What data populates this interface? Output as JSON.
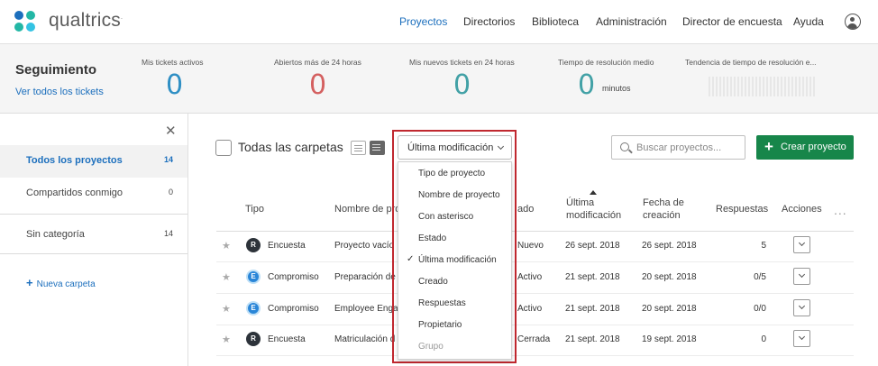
{
  "app": {
    "logo_text": "qualtrics",
    "logo_mark": "."
  },
  "nav": {
    "items": [
      {
        "label": "Proyectos",
        "active": true
      },
      {
        "label": "Directorios"
      },
      {
        "label": "Biblioteca"
      },
      {
        "label": "Administración"
      },
      {
        "label": "Director de encuesta"
      },
      {
        "label": "Ayuda"
      }
    ],
    "user_icon": "user-icon"
  },
  "tracking": {
    "title": "Seguimiento",
    "link": "Ver todos los tickets",
    "metrics": [
      {
        "label": "Mis tickets activos",
        "value": "0",
        "color": "#2f8fc4"
      },
      {
        "label": "Abiertos más de 24 horas",
        "value": "0",
        "color": "#d46060"
      },
      {
        "label": "Mis nuevos tickets en 24 horas",
        "value": "0",
        "color": "#42a1a6"
      },
      {
        "label": "Tiempo de resolución medio",
        "value": "0",
        "unit": "minutos",
        "color": "#42a1a6"
      },
      {
        "label": "Tendencia de tiempo de resolución e..."
      }
    ]
  },
  "sidebar": {
    "close_icon": "close-icon",
    "items": [
      {
        "label": "Todos los proyectos",
        "count": "14",
        "active": true
      },
      {
        "label": "Compartidos conmigo",
        "count": "0"
      },
      {
        "label": "Sin categoría",
        "count": "14"
      }
    ],
    "new_folder": "Nueva carpeta",
    "new_folder_icon": "plus-icon"
  },
  "toolbar": {
    "folders_label": "Todas las carpetas",
    "sort_label": "Última modificación",
    "search_placeholder": "Buscar proyectos...",
    "create_label": "Crear proyecto"
  },
  "table": {
    "headers": {
      "type": "Tipo",
      "name": "Nombre de pro",
      "status": "ado",
      "modified_1": "Última",
      "modified_2": "modificación",
      "created_1": "Fecha de",
      "created_2": "creación",
      "responses": "Respuestas",
      "actions": "Acciones",
      "more": "..."
    },
    "rows": [
      {
        "type": "Encuesta",
        "icon": "R",
        "name": "Proyecto vacío",
        "status": "Nuevo",
        "modified": "26 sept. 2018",
        "created": "26 sept. 2018",
        "responses": "5"
      },
      {
        "type": "Compromiso",
        "icon": "E",
        "name": "Preparación de",
        "status": "Activo",
        "modified": "21 sept. 2018",
        "created": "20 sept. 2018",
        "responses": "0/5"
      },
      {
        "type": "Compromiso",
        "icon": "E",
        "name": "Employee Enga",
        "status": "Activo",
        "modified": "21 sept. 2018",
        "created": "20 sept. 2018",
        "responses": "0/0"
      },
      {
        "type": "Encuesta",
        "icon": "R",
        "name": "Matriculación d",
        "status": "Cerrada",
        "modified": "21 sept. 2018",
        "created": "19 sept. 2018",
        "responses": "0"
      }
    ]
  },
  "sort_menu": {
    "items": [
      {
        "label": "Tipo de proyecto"
      },
      {
        "label": "Nombre de proyecto"
      },
      {
        "label": "Con asterisco"
      },
      {
        "label": "Estado"
      },
      {
        "label": "Última modificación",
        "checked": true
      },
      {
        "label": "Creado"
      },
      {
        "label": "Respuestas"
      },
      {
        "label": "Propietario"
      },
      {
        "label": "Grupo",
        "disabled": true
      }
    ],
    "check_glyph": "✓"
  }
}
